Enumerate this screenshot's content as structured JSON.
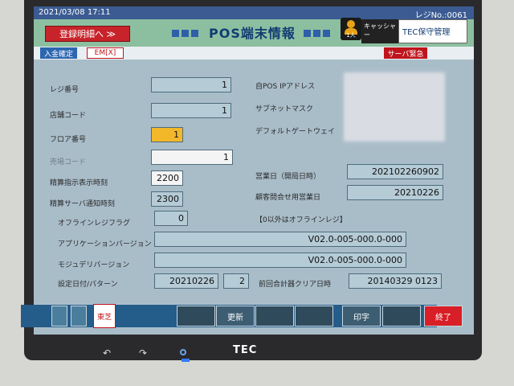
{
  "status": {
    "datetime": "2021/03/08  17:11",
    "register_no": "レジNo.:0061"
  },
  "header": {
    "register_btn": "登録明細へ  ≫",
    "title": "POS端末情報",
    "cashier": "キャッシャー",
    "person_label": "1人",
    "maintenance": "TEC保守管理"
  },
  "strip": {
    "deposit": "入金確定",
    "em": "EM[X]",
    "urgent": "サーバ緊急"
  },
  "fields": [
    {
      "label": "レジ番号",
      "value": "1"
    },
    {
      "label": "店舗コード",
      "value": "1"
    },
    {
      "label": "フロア番号",
      "value": "1"
    },
    {
      "label": "売場コード",
      "value": "1"
    },
    {
      "label": "精算指示表示時刻",
      "value": "2200"
    },
    {
      "label": "精算サーバ通知時刻",
      "value": "2300"
    },
    {
      "label": "オフラインレジフラグ",
      "value": "0"
    }
  ],
  "right": [
    {
      "label": "自POS IPアドレス"
    },
    {
      "label": "サブネットマスク"
    },
    {
      "label": "デフォルトゲートウェイ"
    },
    {
      "label": "営業日（開局日時）",
      "value": "202102260902"
    },
    {
      "label": "顧客問合せ用営業日",
      "value": "20210226"
    }
  ],
  "offline_note": "【0以外はオフラインレジ】",
  "app_version": {
    "label": "アプリケーションバージョン",
    "value": "V02.0-005-000.0-000"
  },
  "module_version": {
    "label": "モジュデリバージョン",
    "value": "V02.0-005-000.0-000"
  },
  "setting": {
    "label": "設定日付/パターン",
    "date": "20210226",
    "pattern": "2",
    "clear_label": "前回合計器クリア日時",
    "clear_value": "20140329 0123"
  },
  "footer": {
    "update": "更新",
    "print": "印字",
    "end": "終了",
    "logo": "東芝"
  },
  "brand": "TEC"
}
